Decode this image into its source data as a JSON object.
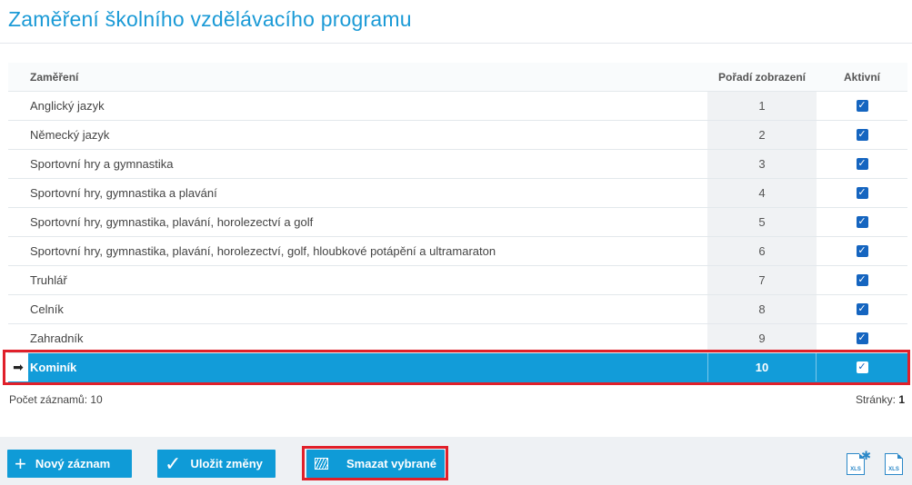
{
  "header": {
    "title": "Zaměření školního vzdělávacího programu"
  },
  "table": {
    "columns": {
      "name": "Zaměření",
      "order": "Pořadí zobrazení",
      "active": "Aktivní"
    },
    "rows": [
      {
        "name": "Anglický jazyk",
        "order": "1",
        "active": true
      },
      {
        "name": "Německý jazyk",
        "order": "2",
        "active": true
      },
      {
        "name": "Sportovní hry a gymnastika",
        "order": "3",
        "active": true
      },
      {
        "name": "Sportovní hry, gymnastika a plavání",
        "order": "4",
        "active": true
      },
      {
        "name": "Sportovní hry, gymnastika, plavání, horolezectví a golf",
        "order": "5",
        "active": true
      },
      {
        "name": "Sportovní hry, gymnastika, plavání, horolezectví, golf, hloubkové potápění a ultramaraton",
        "order": "6",
        "active": true
      },
      {
        "name": "Truhlář",
        "order": "7",
        "active": true
      },
      {
        "name": "Celník",
        "order": "8",
        "active": true
      },
      {
        "name": "Zahradník",
        "order": "9",
        "active": true
      },
      {
        "name": "Kominík",
        "order": "10",
        "active": true,
        "selected": true
      }
    ]
  },
  "footer": {
    "count_label": "Počet záznamů: 10",
    "pages_label": "Stránky:",
    "page": "1"
  },
  "toolbar": {
    "new_label": "Nový záznam",
    "save_label": "Uložit změny",
    "delete_label": "Smazat vybrané",
    "xls_export_settings_text": "XLS",
    "xls_export_text": "XLS"
  },
  "colors": {
    "accent": "#129cd9",
    "highlight": "#e0202a",
    "checkbox": "#1565c0"
  }
}
